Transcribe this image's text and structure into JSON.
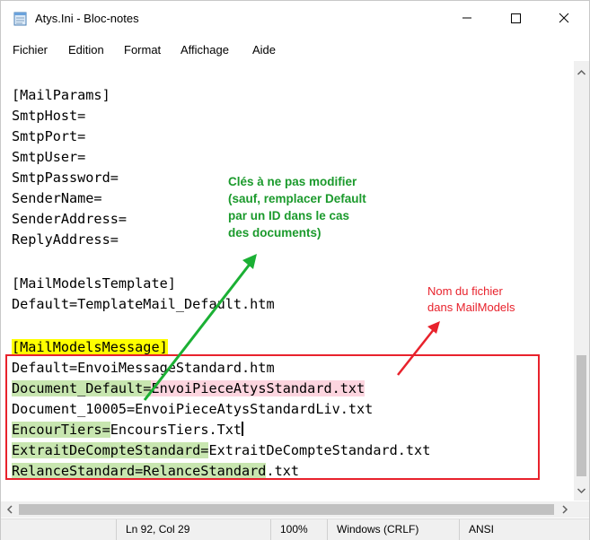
{
  "window": {
    "title": "Atys.Ini - Bloc-notes",
    "min_icon": "minimize-icon",
    "max_icon": "maximize-icon",
    "close_icon": "close-icon"
  },
  "menu": [
    "Fichier",
    "Edition",
    "Format",
    "Affichage",
    "Aide"
  ],
  "lines": {
    "l0": "[MailParams]",
    "l1": "SmtpHost=",
    "l2": "SmtpPort=",
    "l3": "SmtpUser=",
    "l4": "SmtpPassword=",
    "l5": "SenderName=",
    "l6": "SenderAddress=",
    "l7": "ReplyAddress=",
    "l8": "[MailModelsTemplate]",
    "l9": "Default=TemplateMail_Default.htm",
    "l10": "[MailModelsMessage]",
    "l11": "Default=EnvoiMessageStandard.htm",
    "l12a": "Document_Default=",
    "l12b": "EnvoiPieceAtysStandard.txt",
    "l13": "Document_10005=EnvoiPieceAtysStandardLiv.txt",
    "l14a": "EncourTiers=",
    "l14b": "EncoursTiers.Txt",
    "l15a": "ExtraitDeCompteStandard=",
    "l15b": "ExtraitDeCompteStandard.txt",
    "l16a": "RelanceStandard=RelanceStandard",
    "l16b": ".txt"
  },
  "annotations": {
    "green": [
      "Clés à ne pas modifier",
      "(sauf, remplacer Default",
      "par un ID dans le cas",
      "des documents)"
    ],
    "red": [
      "Nom du fichier",
      "dans MailModels"
    ]
  },
  "colors": {
    "green_annotation": "#1b9a2c",
    "red_annotation": "#e8222c",
    "highlight_green": "#c8e6b0",
    "highlight_pink": "#fcd5df",
    "highlight_yellow": "#ffff00"
  },
  "status": {
    "position": "Ln 92, Col 29",
    "zoom": "100%",
    "line_ending": "Windows (CRLF)",
    "encoding": "ANSI"
  }
}
